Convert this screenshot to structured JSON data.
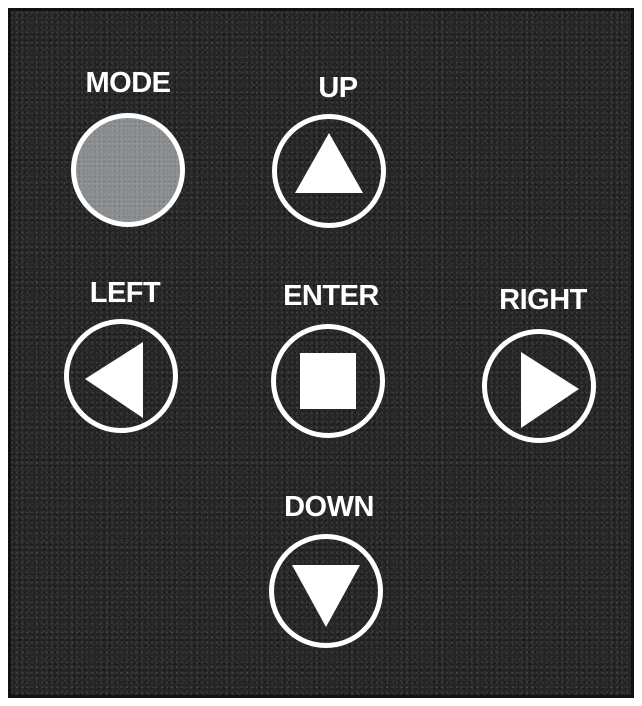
{
  "keypad": {
    "mode_label": "MODE",
    "up_label": "UP",
    "left_label": "LEFT",
    "enter_label": "ENTER",
    "right_label": "RIGHT",
    "down_label": "DOWN"
  },
  "icons": {
    "up": "triangle-up-icon",
    "left": "triangle-left-icon",
    "enter": "square-stop-icon",
    "right": "triangle-right-icon",
    "down": "triangle-down-icon"
  },
  "colors": {
    "panel": "#262626",
    "button_ring": "#ffffff",
    "mode_button_fill": "#8a8d90",
    "label_text": "#ffffff"
  }
}
